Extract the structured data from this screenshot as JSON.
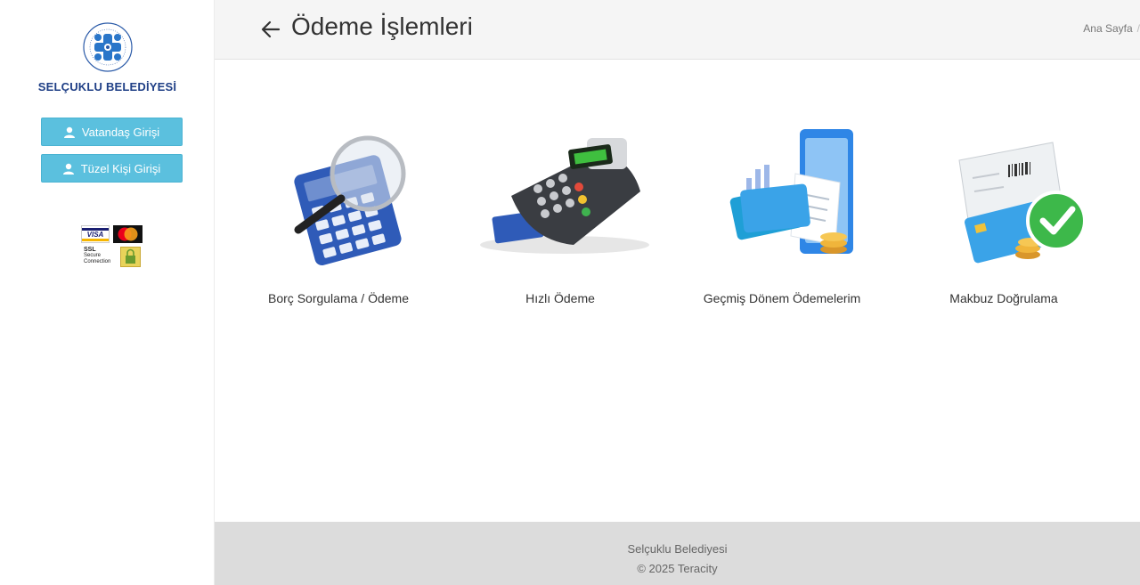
{
  "sidebar": {
    "brand": "SELÇUKLU BELEDİYESİ",
    "buttons": [
      "Vatandaş Girişi",
      "Tüzel Kişi Girişi"
    ],
    "payment_logos": {
      "visa": "VISA",
      "ssl_lines": [
        "SSL",
        "Secure",
        "Connection"
      ]
    }
  },
  "header": {
    "title": "Ödeme İşlemleri",
    "breadcrumb": "Ana Sayfa"
  },
  "cards": [
    {
      "label": "Borç Sorgulama / Ödeme",
      "icon": "calculator-magnifier-icon"
    },
    {
      "label": "Hızlı Ödeme",
      "icon": "pos-terminal-icon"
    },
    {
      "label": "Geçmiş Dönem Ödemelerim",
      "icon": "phone-receipt-cards-icon"
    },
    {
      "label": "Makbuz Doğrulama",
      "icon": "receipt-check-icon"
    }
  ],
  "footer": {
    "line1": "Selçuklu Belediyesi",
    "line2": "© 2025 Teracity"
  },
  "colors": {
    "button": "#5bc0de",
    "brand": "#1f3f86",
    "header_bg": "#f5f5f5",
    "footer_bg": "#dcdcdc"
  }
}
